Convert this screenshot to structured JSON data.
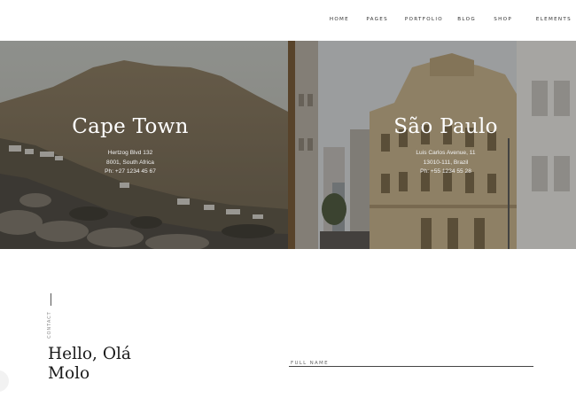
{
  "nav": {
    "items": [
      "HOME",
      "PAGES",
      "PORTFOLIO",
      "BLOG",
      "SHOP",
      "ELEMENTS"
    ]
  },
  "locations": [
    {
      "city": "Cape Town",
      "address_line1": "Hertzog Blvd 132",
      "address_line2": "8001, South Africa",
      "phone": "Ph: +27 1234 45 67"
    },
    {
      "city": "São Paulo",
      "address_line1": "Luis Carlos Avenue, 11",
      "address_line2": "13010-111, Brazil",
      "phone": "Ph: +55 1234 55 28"
    }
  ],
  "contact": {
    "section_label": "CONTACT",
    "heading_line1": "Hello, Olá",
    "heading_line2": "Molo",
    "fullname_placeholder": "FULL NAME"
  }
}
